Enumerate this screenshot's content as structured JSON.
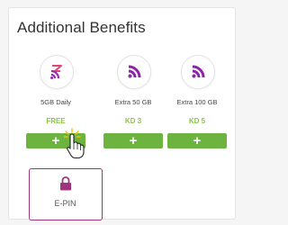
{
  "section": {
    "title": "Additional Benefits"
  },
  "plans": [
    {
      "name": "5GB Daily",
      "price": "FREE",
      "add_label": "+",
      "icon": "wifi-signal-5-icon"
    },
    {
      "name": "Extra 50 GB",
      "price": "KD 3",
      "add_label": "+",
      "icon": "wifi-signal-icon"
    },
    {
      "name": "Extra 100 GB",
      "price": "KD 5",
      "add_label": "+",
      "icon": "wifi-signal-icon"
    }
  ],
  "epin": {
    "label": "E-PIN",
    "icon": "lock-icon"
  },
  "colors": {
    "brand": "#a0337e",
    "price": "#8bc34a",
    "button": "#6cb33f"
  }
}
